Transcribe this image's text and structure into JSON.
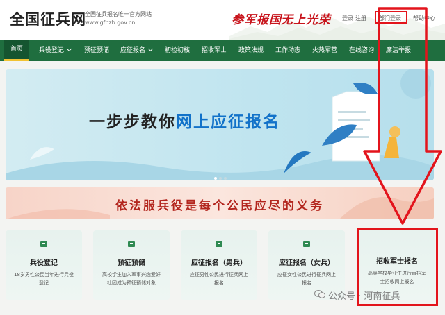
{
  "header": {
    "logo": "全国征兵网",
    "subtitle_line1": "全国征兵报名唯一官方网站",
    "subtitle_line2": "www.gfbzb.gov.cn",
    "slogan1": "参军报国",
    "slogan2": "无上光荣",
    "links": {
      "login": "登录",
      "register": "注册",
      "dept_login": "部门登录",
      "help": "帮助中心"
    }
  },
  "nav": {
    "items": [
      "首页",
      "兵役登记",
      "预征预储",
      "应征报名",
      "初检初核",
      "招收军士",
      "政策法规",
      "工作动态",
      "火热军营",
      "在线咨询",
      "廉洁举报"
    ]
  },
  "banner": {
    "title_part1": "一步步教你",
    "title_part2": "网上应征报名"
  },
  "law_banner": {
    "text": "依法服兵役是每个公民应尽的义务"
  },
  "cards": [
    {
      "title": "兵役登记",
      "desc": "18岁男性公民当年进行兵役登记"
    },
    {
      "title": "预征预储",
      "desc": "高校学生加入军事兴趣爱好社团成为预征预储对象"
    },
    {
      "title": "应征报名（男兵）",
      "desc": "应征男性公民进行征兵网上报名"
    },
    {
      "title": "应征报名（女兵）",
      "desc": "应征女性公民进行征兵网上报名"
    },
    {
      "title": "招收军士报名",
      "desc": "高等学校毕业生进行直招军士招收网上报名"
    }
  ],
  "watermark": "公众号 · 河南征兵",
  "colors": {
    "nav_green": "#1f6e3f",
    "highlight_red": "#e3141c",
    "banner_blue": "#1272c9"
  }
}
